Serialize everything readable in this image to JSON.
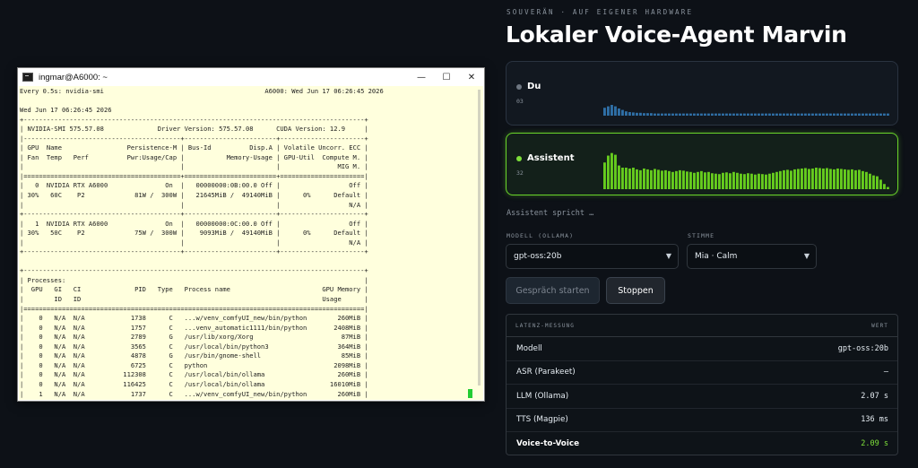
{
  "terminal": {
    "title": "ingmar@A6000: ~",
    "controls": {
      "minimize": "—",
      "maximize": "☐",
      "close": "✕"
    },
    "lines": [
      "Every 0.5s: nvidia-smi                                          A6000: Wed Jun 17 06:26:45 2026",
      "",
      "Wed Jun 17 06:26:45 2026",
      "+-----------------------------------------------------------------------------------------+",
      "| NVIDIA-SMI 575.57.08              Driver Version: 575.57.08      CUDA Version: 12.9     |",
      "|-----------------------------------------+------------------------+----------------------+",
      "| GPU  Name                 Persistence-M | Bus-Id          Disp.A | Volatile Uncorr. ECC |",
      "| Fan  Temp   Perf          Pwr:Usage/Cap |           Memory-Usage | GPU-Util  Compute M. |",
      "|                                         |                        |               MIG M. |",
      "|=========================================+========================+======================|",
      "|   0  NVIDIA RTX A6000               On  |   00000000:0B:00.0 Off |                  Off |",
      "| 30%   60C    P2             81W /  300W |   21645MiB /  49140MiB |      0%      Default |",
      "|                                         |                        |                  N/A |",
      "+-----------------------------------------+------------------------+----------------------+",
      "|   1  NVIDIA RTX A6000               On  |   00000000:0C:00.0 Off |                  Off |",
      "| 30%   50C    P2             75W /  300W |    9093MiB /  49140MiB |      0%      Default |",
      "|                                         |                        |                  N/A |",
      "+-----------------------------------------+------------------------+----------------------+",
      "",
      "+-----------------------------------------------------------------------------------------+",
      "| Processes:                                                                              |",
      "|  GPU   GI   CI              PID   Type   Process name                        GPU Memory |",
      "|        ID   ID                                                               Usage      |",
      "|=========================================================================================|",
      "|    0   N/A  N/A            1738      C   ...w/venv_comfyUI_new/bin/python        260MiB |",
      "|    0   N/A  N/A            1757      C   ...venv_automatic1111/bin/python       2408MiB |",
      "|    0   N/A  N/A            2789      G   /usr/lib/xorg/Xorg                       87MiB |",
      "|    0   N/A  N/A            3565      C   /usr/local/bin/python3                  364MiB |",
      "|    0   N/A  N/A            4878      G   /usr/bin/gnome-shell                     85MiB |",
      "|    0   N/A  N/A            6725      C   python                                 2098MiB |",
      "|    0   N/A  N/A          112308      C   /usr/local/bin/ollama                   260MiB |",
      "|    0   N/A  N/A          116425      C   /usr/local/bin/ollama                 16010MiB |",
      "|    1   N/A  N/A            1737      C   ...w/venv_comfyUI_new/bin/python        260MiB |"
    ]
  },
  "header": {
    "eyebrow": "SOUVERÄN · AUF EIGENER HARDWARE",
    "title": "Lokaler Voice-Agent Marvin"
  },
  "voices": {
    "du": {
      "name": "Du",
      "level": "03",
      "color": "#2f6fa6",
      "bars": [
        0.22,
        0.26,
        0.3,
        0.26,
        0.2,
        0.16,
        0.12,
        0.1,
        0.09,
        0.08,
        0.08,
        0.07,
        0.07,
        0.07,
        0.06,
        0.06,
        0.06,
        0.06,
        0.06,
        0.06,
        0.06,
        0.06,
        0.06,
        0.06,
        0.06,
        0.06,
        0.06,
        0.06,
        0.06,
        0.06,
        0.06,
        0.06,
        0.06,
        0.06,
        0.06,
        0.06,
        0.06,
        0.06,
        0.06,
        0.06,
        0.06,
        0.06,
        0.06,
        0.06,
        0.06,
        0.06,
        0.06,
        0.06,
        0.06,
        0.06,
        0.06,
        0.06,
        0.06,
        0.06,
        0.06,
        0.06,
        0.06,
        0.06,
        0.06,
        0.06,
        0.06,
        0.06,
        0.06,
        0.06,
        0.06,
        0.06,
        0.06,
        0.06,
        0.06,
        0.06,
        0.06,
        0.06,
        0.06,
        0.06,
        0.06,
        0.06,
        0.06,
        0.06,
        0.06,
        0.06
      ]
    },
    "assistant": {
      "name": "Assistent",
      "level": "32",
      "color": "#66cc1e",
      "bars": [
        0.62,
        0.78,
        0.84,
        0.8,
        0.55,
        0.5,
        0.5,
        0.48,
        0.5,
        0.46,
        0.44,
        0.48,
        0.46,
        0.44,
        0.47,
        0.45,
        0.43,
        0.44,
        0.42,
        0.4,
        0.42,
        0.44,
        0.43,
        0.41,
        0.4,
        0.38,
        0.4,
        0.42,
        0.39,
        0.4,
        0.37,
        0.36,
        0.35,
        0.38,
        0.39,
        0.37,
        0.4,
        0.38,
        0.36,
        0.35,
        0.37,
        0.36,
        0.34,
        0.36,
        0.35,
        0.34,
        0.36,
        0.38,
        0.4,
        0.42,
        0.44,
        0.45,
        0.43,
        0.46,
        0.47,
        0.48,
        0.49,
        0.47,
        0.48,
        0.5,
        0.49,
        0.48,
        0.49,
        0.47,
        0.46,
        0.48,
        0.47,
        0.46,
        0.45,
        0.46,
        0.44,
        0.45,
        0.42,
        0.4,
        0.36,
        0.32,
        0.3,
        0.22,
        0.12,
        0.05
      ]
    }
  },
  "status": "Assistent spricht …",
  "model_select": {
    "label": "MODELL (OLLAMA)",
    "value": "gpt-oss:20b"
  },
  "voice_select": {
    "label": "STIMME",
    "value": "Mia · Calm"
  },
  "buttons": {
    "start": "Gespräch starten",
    "stop": "Stoppen"
  },
  "latency": {
    "col_label": "LATENZ-MESSUNG",
    "col_value": "WERT",
    "rows": [
      {
        "label": "Modell",
        "value": "gpt-oss:20b"
      },
      {
        "label": "ASR (Parakeet)",
        "value": "–"
      },
      {
        "label": "LLM (Ollama)",
        "value": "2.07 s"
      },
      {
        "label": "TTS (Magpie)",
        "value": "136 ms"
      },
      {
        "label": "Voice-to-Voice",
        "value": "2.09 s"
      }
    ]
  }
}
